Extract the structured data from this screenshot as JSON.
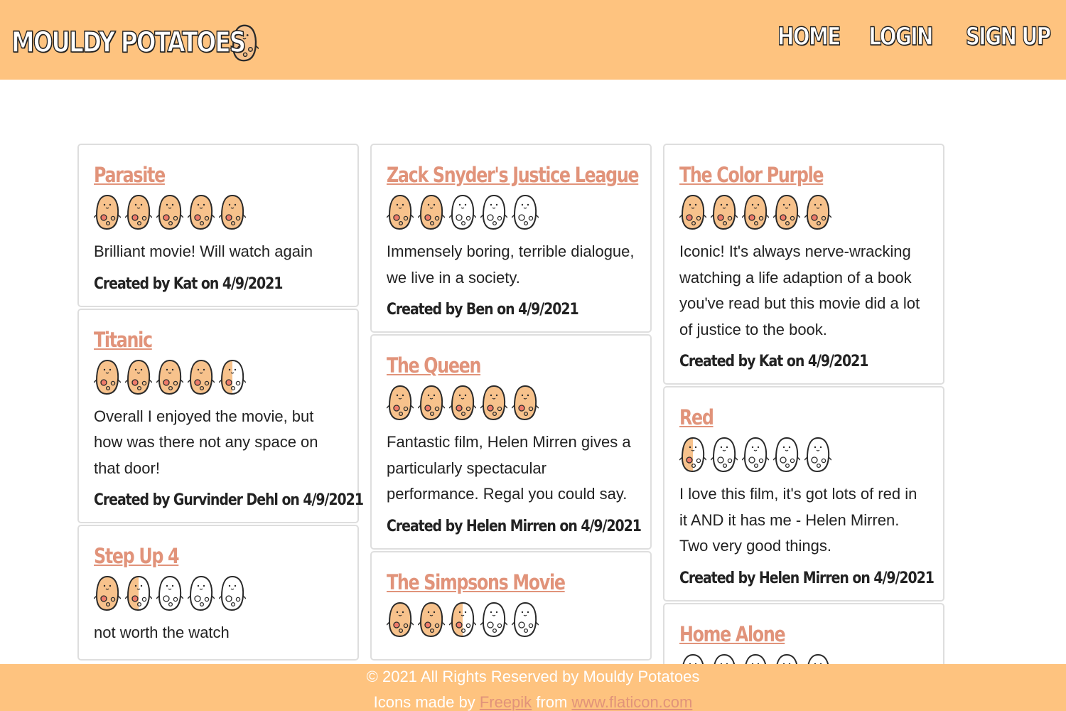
{
  "brand": {
    "name": "MOULDY POTATOES",
    "icon": "potato-icon"
  },
  "nav": [
    {
      "label": "HOME"
    },
    {
      "label": "LOGIN"
    },
    {
      "label": "SIGN UP"
    }
  ],
  "colors": {
    "header_bg": "#fec37f",
    "title_link": "#e1937a",
    "potato_filled": "#f7c28c",
    "potato_empty": "#ffffff"
  },
  "columns": [
    [
      {
        "title": "Parasite",
        "rating": 5,
        "review": "Brilliant movie! Will watch again",
        "author": "Created by Kat on 4/9/2021"
      },
      {
        "title": "Titanic",
        "rating": 4.5,
        "review": "Overall I enjoyed the movie, but how was there not any space on that door!",
        "author": "Created by Gurvinder Dehl on 4/9/2021"
      },
      {
        "title": "Step Up 4",
        "rating": 1.5,
        "review": "not worth the watch",
        "author": ""
      }
    ],
    [
      {
        "title": "Zack Snyder's Justice League",
        "rating": 2,
        "review": "Immensely boring, terrible dialogue, we live in a society.",
        "author": "Created by Ben on 4/9/2021"
      },
      {
        "title": "The Queen",
        "rating": 5,
        "review": "Fantastic film, Helen Mirren gives a particularly spectacular performance. Regal you could say.",
        "author": "Created by Helen Mirren on 4/9/2021"
      },
      {
        "title": "The Simpsons Movie",
        "rating": 2.5,
        "review": "",
        "author": ""
      }
    ],
    [
      {
        "title": "The Color Purple",
        "rating": 5,
        "review": "Iconic! It's always nerve-wracking watching a life adaption of a book you've read but this movie did a lot of justice to the book.",
        "author": "Created by Kat on 4/9/2021"
      },
      {
        "title": "Red",
        "rating": 0.5,
        "review": "I love this film, it's got lots of red in it AND it has me - Helen Mirren. Two very good things.",
        "author": "Created by Helen Mirren on 4/9/2021"
      },
      {
        "title": "Home Alone",
        "rating": 0,
        "review": "",
        "author": ""
      }
    ]
  ],
  "footer": {
    "copyright": "© 2021 All Rights Reserved by Mouldy Potatoes",
    "credit_prefix": "Icons made by ",
    "credit_link1": "Freepik",
    "credit_mid": " from ",
    "credit_link2": "www.flaticon.com"
  }
}
